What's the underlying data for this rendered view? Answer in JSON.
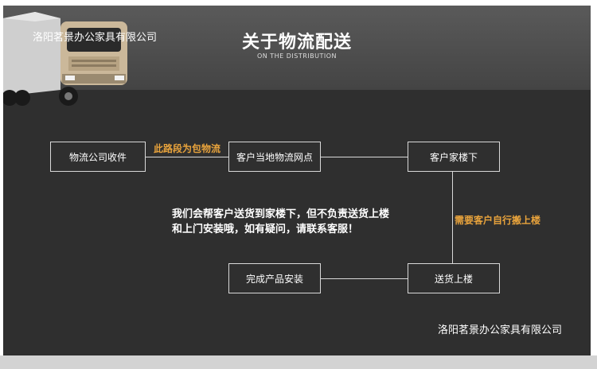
{
  "header": {
    "company": "洛阳茗景办公家具有限公司",
    "title": "关于物流配送",
    "subtitle": "ON THE DISTRIBUTION"
  },
  "flow": {
    "box_pickup": "物流公司收件",
    "box_local_outlet": "客户当地物流网点",
    "box_downstairs": "客户家楼下",
    "box_delivery_upstairs": "送货上楼",
    "box_install": "完成产品安装",
    "note_included": "此路段为包物流",
    "note_self_carry": "需要客户自行搬上楼"
  },
  "message": {
    "line1": "我们会帮客户送货到家楼下，但不负责送货上楼",
    "line2": "和上门安装哦，如有疑问，请联系客服！"
  },
  "footer": {
    "company": "洛阳茗景办公家具有限公司"
  },
  "colors": {
    "panel": "#2f2f2f",
    "accent": "#e8a33c",
    "line": "#d9d9d9"
  }
}
